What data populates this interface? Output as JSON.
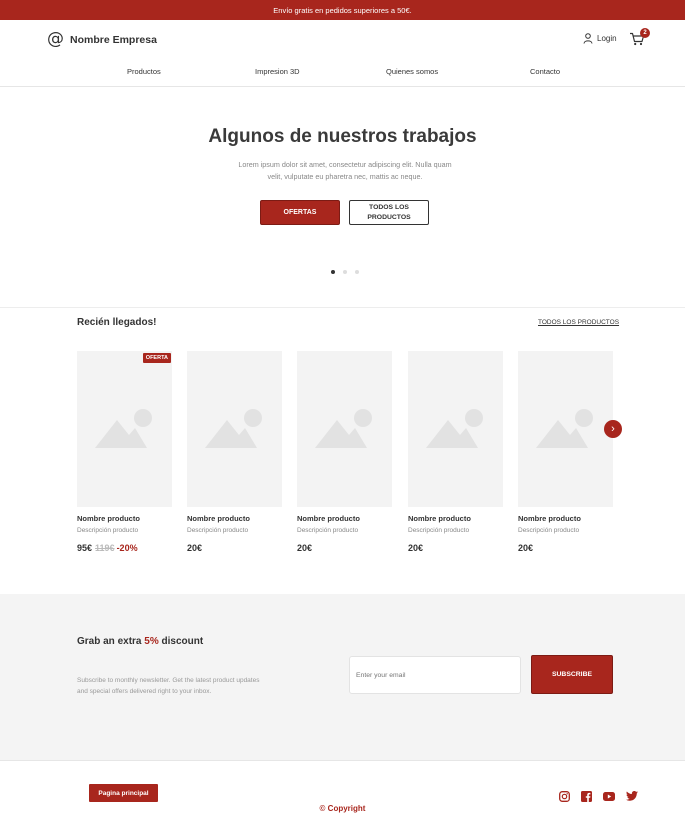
{
  "topbar": {
    "text": "Envío gratis en pedidos superiores a 50€."
  },
  "header": {
    "brand_name": "Nombre Empresa",
    "login_label": "Login",
    "cart_count": "2"
  },
  "nav": {
    "items": [
      {
        "label": "Productos"
      },
      {
        "label": "Impresion 3D"
      },
      {
        "label": "Quienes somos"
      },
      {
        "label": "Contacto"
      }
    ]
  },
  "hero": {
    "title": "Algunos de nuestros trabajos",
    "text": "Lorem ipsum dolor sit amet, consectetur adipiscing elit. Nulla quam velit, vulputate eu pharetra nec, mattis ac neque.",
    "primary_button": "OFERTAS",
    "secondary_button": "TODOS LOS PRODUCTOS",
    "slide_count": 3,
    "active_slide": 1
  },
  "arrivals": {
    "title": "Recién llegados!",
    "all_link": "TODOS LOS PRODUCTOS",
    "products": [
      {
        "name": "Nombre producto",
        "description": "Descripción producto",
        "price": "95€",
        "old_price": "119€",
        "discount": "-20%",
        "badge": "OFERTA"
      },
      {
        "name": "Nombre producto",
        "description": "Descripción producto",
        "price": "20€"
      },
      {
        "name": "Nombre producto",
        "description": "Descripción producto",
        "price": "20€"
      },
      {
        "name": "Nombre producto",
        "description": "Descripción producto",
        "price": "20€"
      },
      {
        "name": "Nombre producto",
        "description": "Descripción producto",
        "price": "20€"
      }
    ]
  },
  "newsletter": {
    "title_prefix": "Grab an extra",
    "title_accent": "5%",
    "title_suffix": "discount",
    "text": "Subscribe to monthly newsletter. Get the latest product updates and special offers delivered right to your inbox.",
    "email_placeholder": "Enter your email",
    "button": "SUBSCRIBE"
  },
  "footer": {
    "home_button": "Pagina principal",
    "copyright": "© Copyright",
    "social_icons": [
      "instagram-icon",
      "facebook-icon",
      "youtube-icon",
      "twitter-icon"
    ]
  },
  "colors": {
    "accent": "#a8261d",
    "text": "#333333",
    "muted": "#888888",
    "panel": "#f4f4f4"
  }
}
